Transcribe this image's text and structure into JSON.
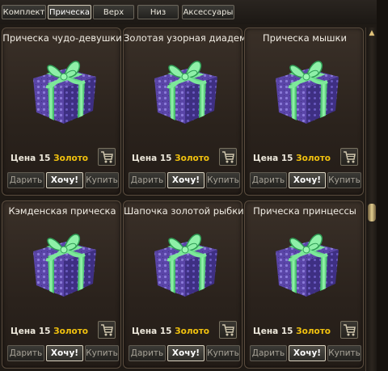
{
  "tabs": [
    {
      "label": "Комплект",
      "active": false
    },
    {
      "label": "Прическа",
      "active": true
    },
    {
      "label": "Верх",
      "active": false
    },
    {
      "label": "Низ",
      "active": false
    },
    {
      "label": "Аксессуары",
      "active": false
    }
  ],
  "items": [
    {
      "title": "Прическа чудо-девушки",
      "price_label": "Цена",
      "price": "15",
      "currency": "Золото",
      "gift_label": "Дарить",
      "want_label": "Хочу!",
      "buy_label": "Купить"
    },
    {
      "title": "Золотая узорная диадема",
      "price_label": "Цена",
      "price": "15",
      "currency": "Золото",
      "gift_label": "Дарить",
      "want_label": "Хочу!",
      "buy_label": "Купить"
    },
    {
      "title": "Прическа мышки",
      "price_label": "Цена",
      "price": "15",
      "currency": "Золото",
      "gift_label": "Дарить",
      "want_label": "Хочу!",
      "buy_label": "Купить"
    },
    {
      "title": "Кэмденская прическа",
      "price_label": "Цена",
      "price": "15",
      "currency": "Золото",
      "gift_label": "Дарить",
      "want_label": "Хочу!",
      "buy_label": "Купить"
    },
    {
      "title": "Шапочка золотой рыбки",
      "price_label": "Цена",
      "price": "15",
      "currency": "Золото",
      "gift_label": "Дарить",
      "want_label": "Хочу!",
      "buy_label": "Купить"
    },
    {
      "title": "Прическа принцессы",
      "price_label": "Цена",
      "price": "15",
      "currency": "Золото",
      "gift_label": "Дарить",
      "want_label": "Хочу!",
      "buy_label": "Купить"
    }
  ],
  "icons": {
    "item": "gift-box-icon",
    "cart": "shopping-cart-icon",
    "scroll_up": "chevron-up-icon"
  },
  "colors": {
    "gold": "#f2c20e",
    "ribbon": "#6fe58f",
    "box": "#5a45a8"
  }
}
